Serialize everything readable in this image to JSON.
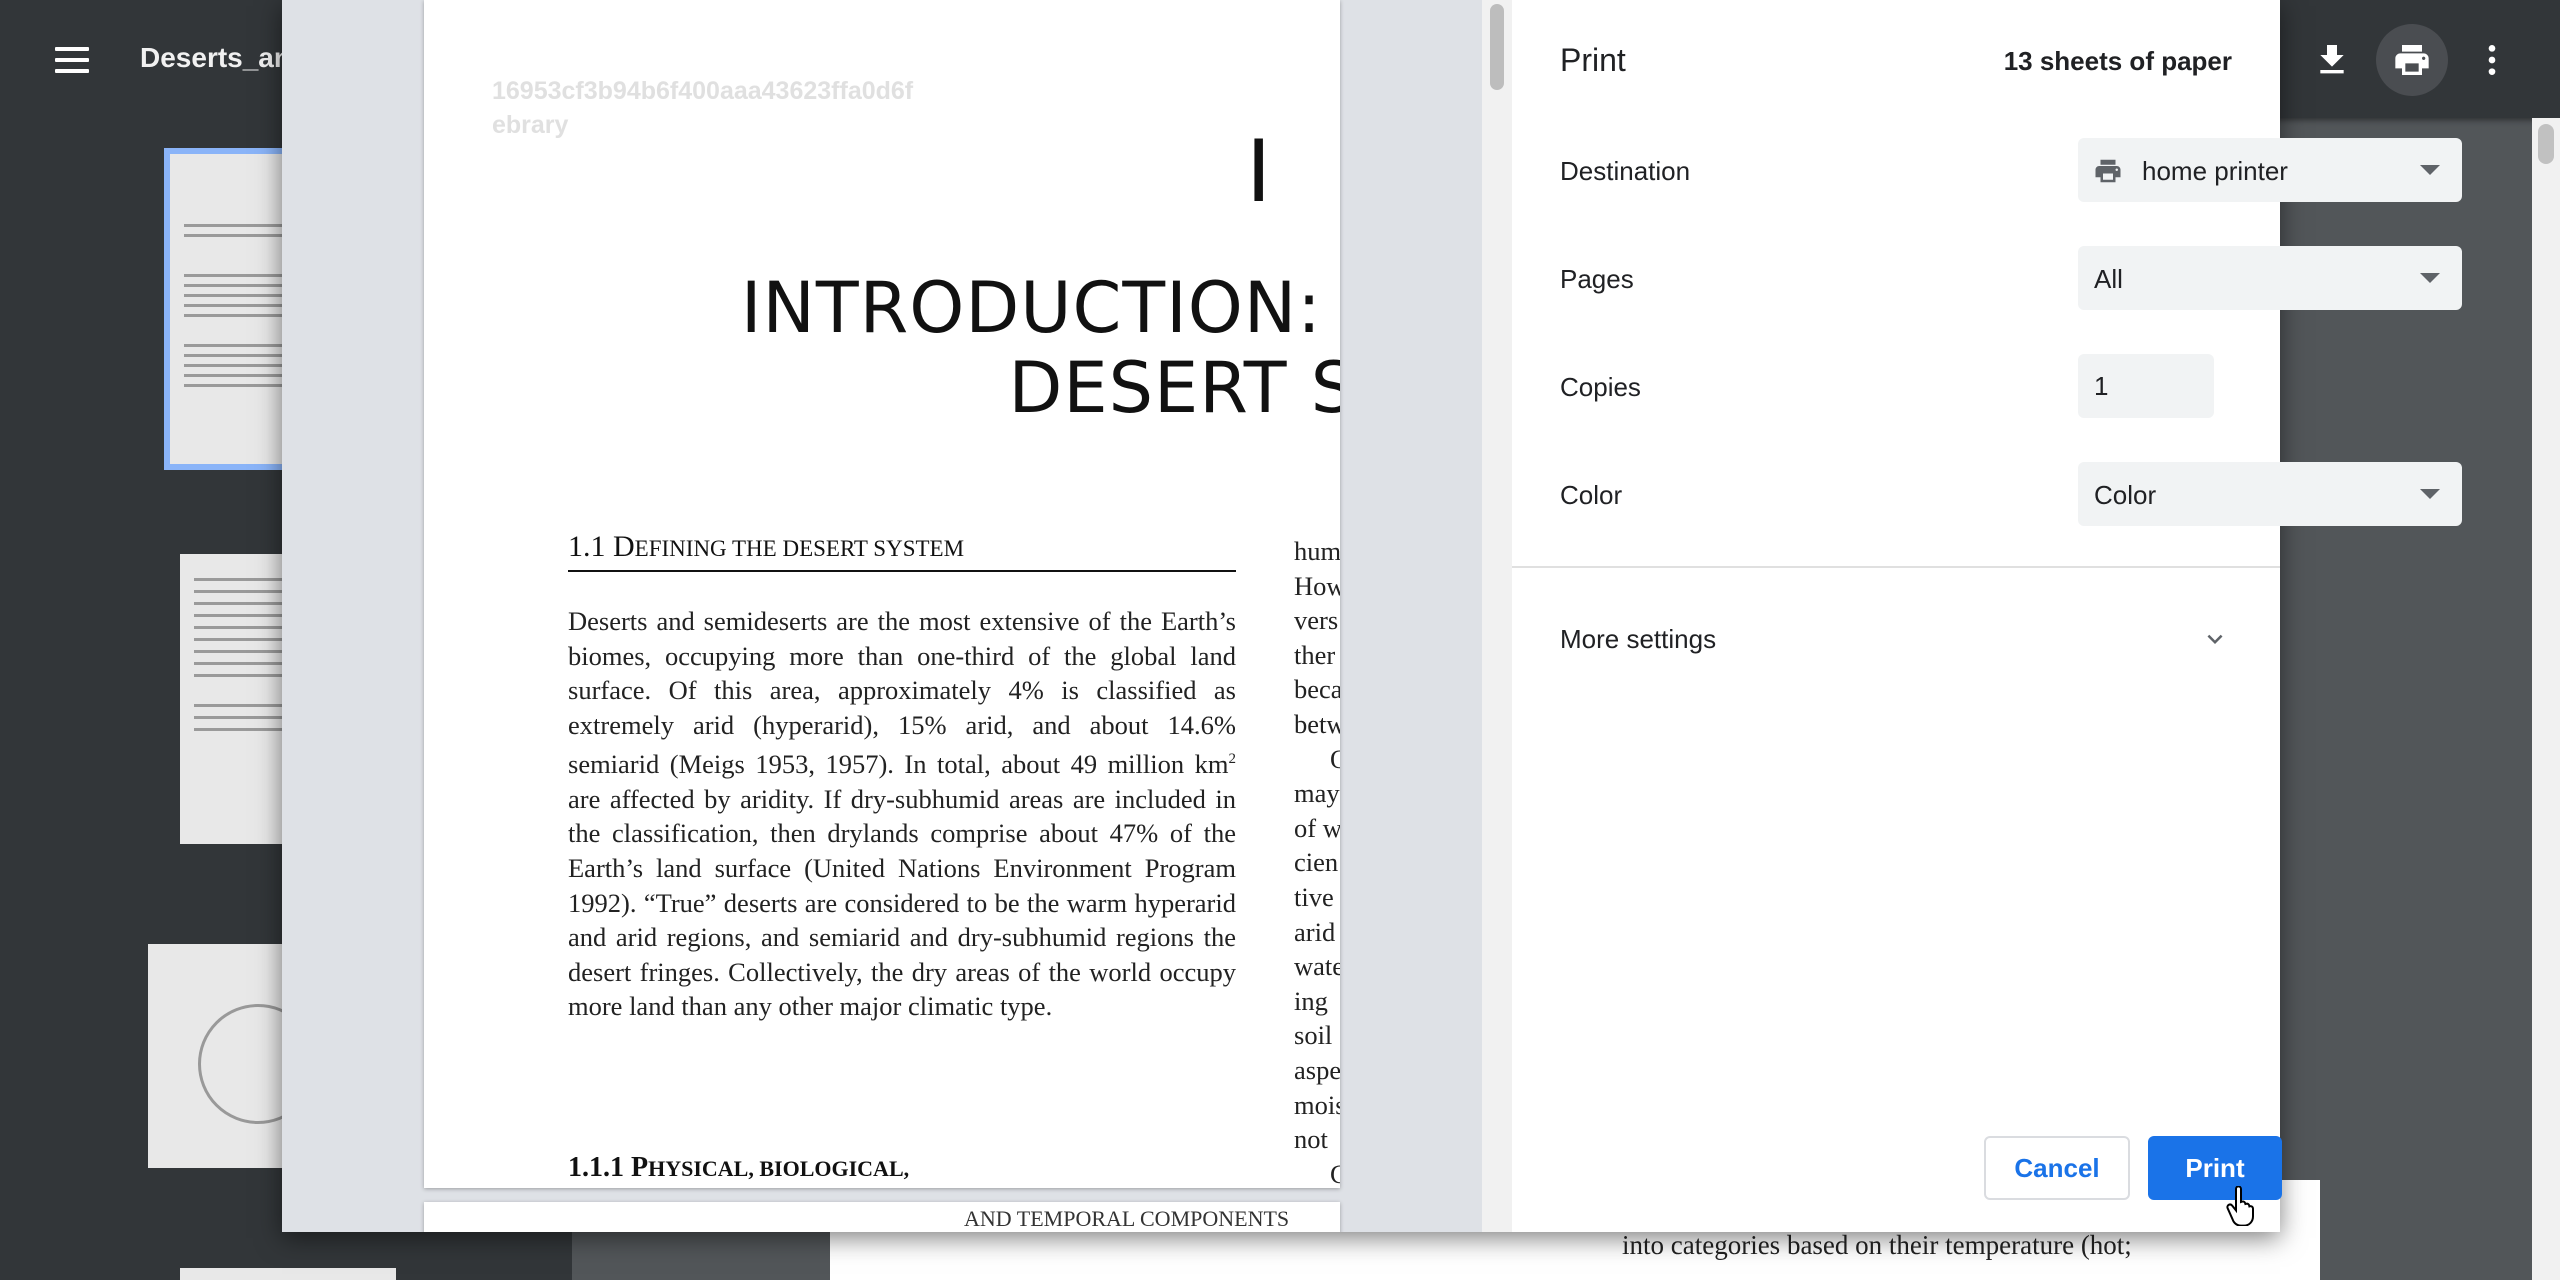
{
  "viewer": {
    "title": "Deserts_and",
    "bottom_page_text": "into categories based on their temperature (hot;",
    "icons": {
      "menu": "hamburger-menu-icon",
      "download": "download-icon",
      "print": "print-icon",
      "more": "more-vert-icon"
    }
  },
  "print_dialog": {
    "title": "Print",
    "sheets_label": "13 sheets of paper",
    "destination": {
      "label": "Destination",
      "value": "home printer",
      "icon": "printer-icon"
    },
    "pages": {
      "label": "Pages",
      "value": "All"
    },
    "copies": {
      "label": "Copies",
      "value": "1"
    },
    "color": {
      "label": "Color",
      "value": "Color"
    },
    "more_settings": {
      "label": "More settings",
      "icon": "chevron-down-icon"
    },
    "cancel_label": "Cancel",
    "print_label": "Print",
    "accent_color": "#1a73e8"
  },
  "preview": {
    "watermark_line1": "16953cf3b94b6f400aaa43623ffa0d6f",
    "watermark_line2": "ebrary",
    "chapter_number": "I",
    "chapter_title_line1": "INTRODUCTION: D",
    "chapter_title_line2": "DESERT SY",
    "section_number": "1.1 ",
    "section_first": "D",
    "section_rest": "EFINING THE DESERT SYSTEM",
    "body_part1": "Deserts and semideserts are the most extensive of the Earth’s biomes, occupying more than one-third of the global land surface. Of this area, approximately 4% is classified as extremely arid (hyperarid), 15% arid, and about 14.6% semiarid (Meigs 1953, 1957). In total, about 49 million km",
    "body_sup": "2",
    "body_part2": " are affected by aridity. If dry-subhumid areas are included in the classification, then drylands comprise about 47% of the Earth’s land surface (United Nations Environment Program 1992). “True” deserts are considered to be the warm hyperarid and arid regions, and semiarid and dry-subhumid regions the desert fringes. Collectively, the dry areas of the world occupy more land than any other major climatic type.",
    "col2_lines": [
      "hum",
      "How",
      "vers",
      "ther",
      "beca",
      "betw",
      "O",
      "may",
      "of w",
      "cien",
      "tive",
      "arid",
      "wate",
      "ing",
      "soil",
      "aspe",
      "mois",
      "not",
      "C"
    ],
    "subsection_number": "1.1.1 ",
    "subsection_first": "P",
    "subsection_rest": "HYSICAL, BIOLOGICAL,",
    "page2_text": "AND TEMPORAL COMPONENTS"
  }
}
